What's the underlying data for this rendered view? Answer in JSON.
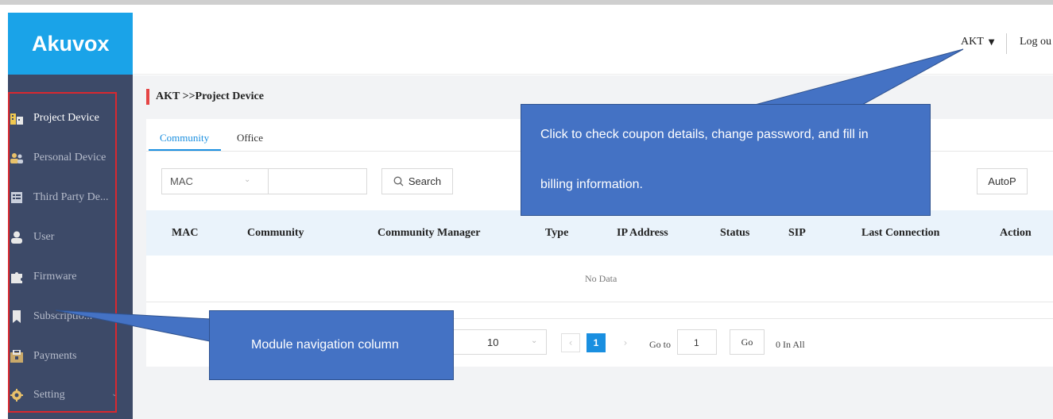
{
  "app": {
    "logo": "Akuvox"
  },
  "header": {
    "user": "AKT",
    "logout": "Log ou"
  },
  "sidebar": {
    "items": [
      {
        "label": "Project Device",
        "icon": "building-icon",
        "active": true
      },
      {
        "label": "Personal Device",
        "icon": "users-icon",
        "active": false
      },
      {
        "label": "Third Party De...",
        "icon": "device-list-icon",
        "active": false
      },
      {
        "label": "User",
        "icon": "user-icon",
        "active": false
      },
      {
        "label": "Firmware",
        "icon": "puzzle-icon",
        "active": false
      },
      {
        "label": "Subscriptio...",
        "icon": "bookmark-icon",
        "active": false
      },
      {
        "label": "Payments",
        "icon": "cart-icon",
        "active": false
      },
      {
        "label": "Setting",
        "icon": "gear-icon",
        "active": false
      }
    ]
  },
  "breadcrumb": "AKT >>Project Device",
  "tabs": [
    {
      "label": "Community",
      "active": true
    },
    {
      "label": "Office",
      "active": false
    }
  ],
  "filter": {
    "field": "MAC",
    "search_value": "",
    "search_button": "Search",
    "autop_button": "AutoP"
  },
  "table": {
    "columns": [
      "MAC",
      "Community",
      "Community Manager",
      "Type",
      "IP Address",
      "Status",
      "SIP",
      "Last Connection",
      "Action"
    ],
    "empty_text": "No Data"
  },
  "pagination": {
    "page_size": "10",
    "current_page": "1",
    "goto_label": "Go to",
    "goto_value": "1",
    "go_button": "Go",
    "total": "0 In All"
  },
  "annotations": {
    "top": {
      "line1": "Click to check coupon details, change password, and fill in",
      "line2": "billing information."
    },
    "left": {
      "text": "Module navigation column"
    }
  },
  "colors": {
    "brand": "#1aa3e8",
    "sidebar": "#3d4a68",
    "accent": "#1a8fe0",
    "callout": "#4472c4",
    "highlight": "#d9282f"
  }
}
